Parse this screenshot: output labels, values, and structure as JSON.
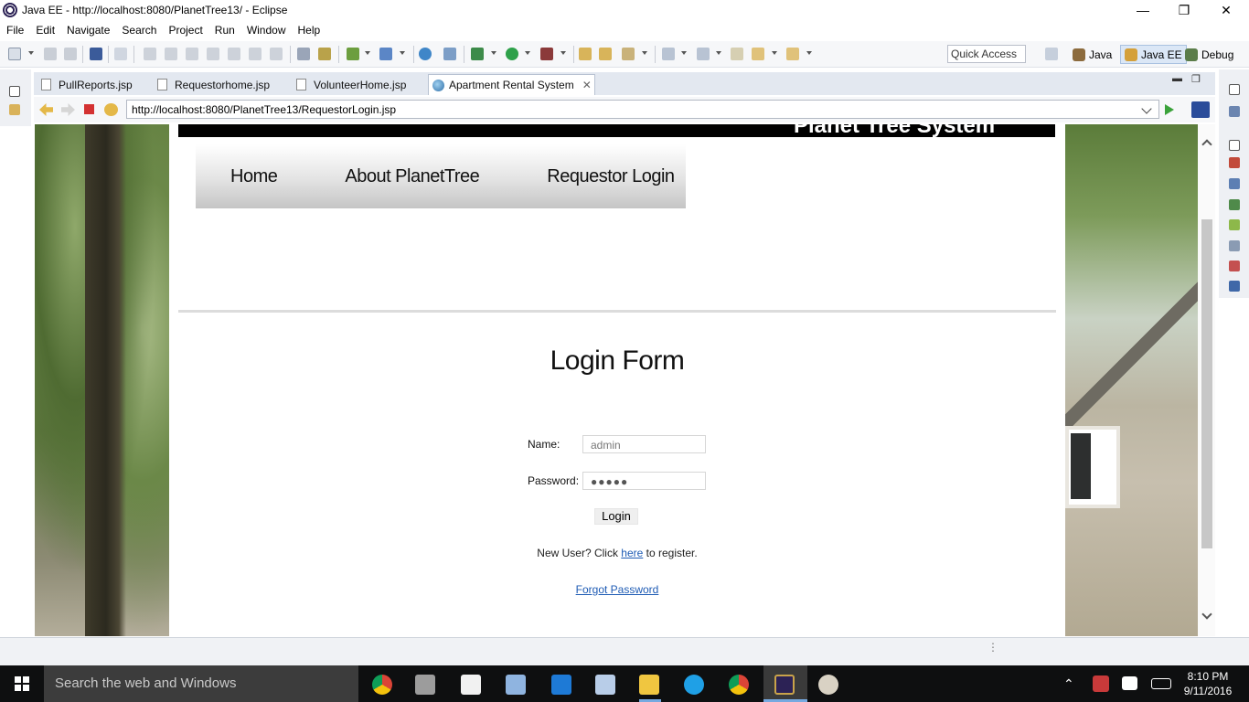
{
  "window": {
    "title": "Java EE - http://localhost:8080/PlanetTree13/ - Eclipse",
    "controls": [
      "—",
      "❐",
      "✕"
    ]
  },
  "menubar": {
    "items": [
      "File",
      "Edit",
      "Navigate",
      "Search",
      "Project",
      "Run",
      "Window",
      "Help"
    ]
  },
  "toolbar": {
    "quick_access": "Quick Access",
    "perspectives": [
      {
        "label": "Java",
        "active": false
      },
      {
        "label": "Java EE",
        "active": true
      },
      {
        "label": "Debug",
        "active": false
      }
    ]
  },
  "editor_tabs": [
    {
      "label": "PullReports.jsp",
      "active": false
    },
    {
      "label": "Requestorhome.jsp",
      "active": false
    },
    {
      "label": "VolunteerHome.jsp",
      "active": false
    },
    {
      "label": "Apartment Rental System",
      "active": true,
      "close": "✕"
    }
  ],
  "browser": {
    "url": "http://localhost:8080/PlanetTree13/RequestorLogin.jsp"
  },
  "page": {
    "site_title": "Planet Tree System",
    "nav": [
      "Home",
      "About PlanetTree",
      "Requestor Login"
    ],
    "form_title": "Login Form",
    "name_label": "Name:",
    "name_value": "admin",
    "password_label": "Password:",
    "password_value": "●●●●●",
    "login_button": "Login",
    "register_prefix": "New User? Click ",
    "register_link": "here",
    "register_suffix": " to register.",
    "forgot_link": "Forgot Password"
  },
  "taskbar": {
    "search_placeholder": "Search the web and Windows",
    "time": "8:10 PM",
    "date": "9/11/2016"
  },
  "colors": {
    "link": "#1e5bb4",
    "active_perspective_bg": "#dbe7f6",
    "taskbar_bg": "#0e0f10"
  }
}
